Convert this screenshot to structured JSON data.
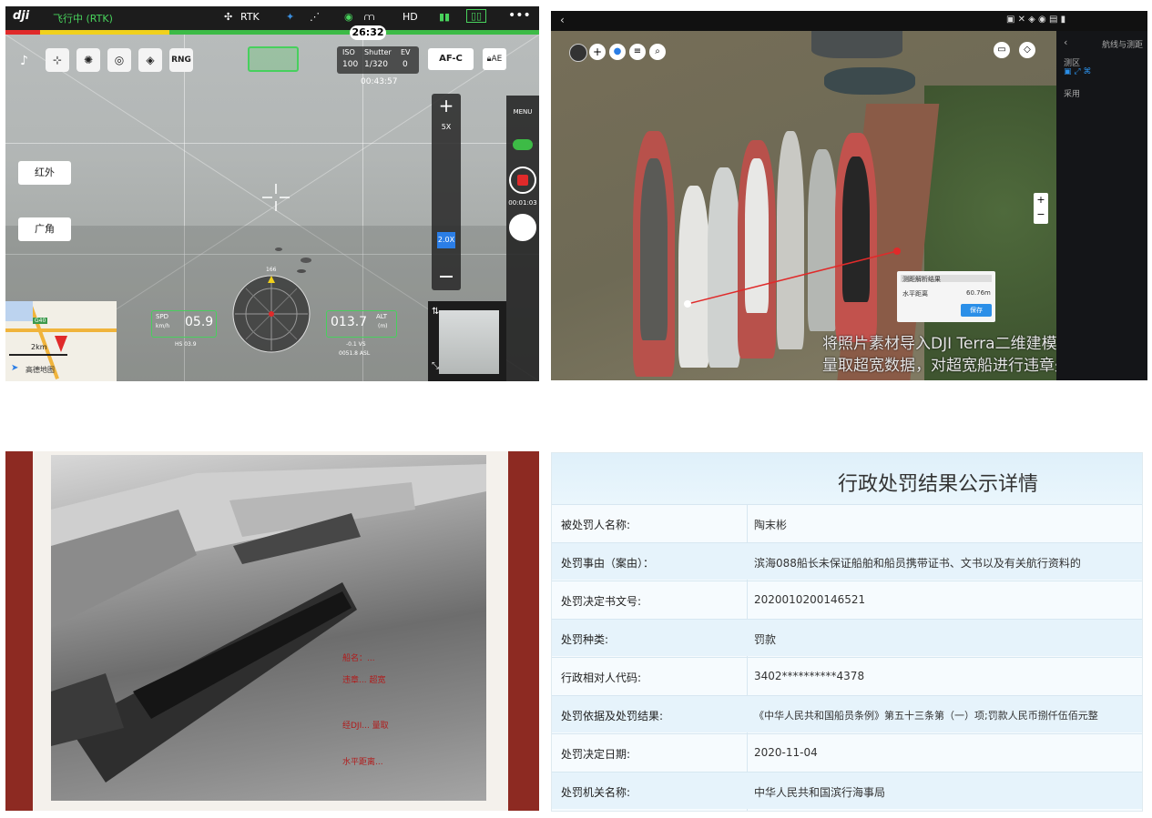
{
  "pilot": {
    "logo": "dji",
    "status": "飞行中 (RTK)",
    "rtk": "RTK",
    "hd": "HD",
    "menu": "•••",
    "time_badge": "26:32",
    "tools": [
      "RNG"
    ],
    "iso_label": "ISO",
    "iso_value": "100",
    "shutter_label": "Shutter",
    "shutter_value": "1/320",
    "ev_label": "EV",
    "ev_value": "0",
    "af_mode": "AF-C",
    "ae": "AE",
    "rec_time": "00:43:57",
    "zoom_top": "5X",
    "zoom_current": "2.0X",
    "menu_label": "MENU",
    "elapsed": "00:01:03",
    "ir_button": "红外",
    "wide_button": "广角",
    "spd_label": "SPD",
    "spd_unit": "km/h",
    "spd_value": "05.9",
    "alt_label": "ALT",
    "alt_unit": "(m)",
    "alt_value": "013.7",
    "vs_text": "-0.1 VS",
    "asl_text": "0051.8 ASL",
    "hs_text": "HS 03.9",
    "heading": "166",
    "map_scale": "2km",
    "map_provider": "高德地图",
    "map_tag": "G40"
  },
  "terra": {
    "sidebar_title": "航线与测距",
    "sidebar_label": "测区",
    "sidebar_sub": "采用",
    "dialog_title": "测距解析结果",
    "dialog_label": "水平距离",
    "dialog_value": "60.76m",
    "dialog_button": "保存",
    "caption_line1": "将照片素材导入DJI Terra二维建模",
    "caption_line2": "量取超宽数据，对超宽船进行违章处罚"
  },
  "photo": {
    "notes": [
      "船名：...",
      "违章... 超宽",
      "经DJI... 量取",
      "水平距离..."
    ]
  },
  "penalty": {
    "title": "行政处罚结果公示详情",
    "rows": [
      {
        "label": "被处罚人名称:",
        "value": "陶末彬"
      },
      {
        "label": "处罚事由（案由）：",
        "value": "滨海088船长未保证船舶和船员携带证书、文书以及有关航行资料的"
      },
      {
        "label": "处罚决定书文号:",
        "value": "2020010200146521"
      },
      {
        "label": "处罚种类:",
        "value": "罚款"
      },
      {
        "label": "行政相对人代码:",
        "value": "3402**********4378"
      },
      {
        "label": "处罚依据及处罚结果:",
        "value": "《中华人民共和国船员条例》第五十三条第（一）项;罚款人民币捌仟伍佰元整"
      },
      {
        "label": "处罚决定日期:",
        "value": "2020-11-04"
      },
      {
        "label": "处罚机关名称:",
        "value": "中华人民共和国滨行海事局"
      }
    ]
  },
  "colors": {
    "osd_green": "#47d05d",
    "table_header": "#dff0fa",
    "photo_bg": "#8d2a22"
  }
}
